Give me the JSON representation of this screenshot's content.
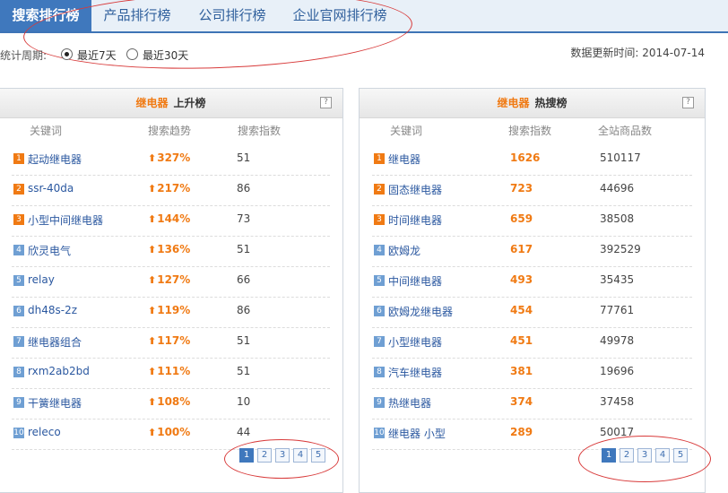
{
  "tabs": [
    {
      "label": "搜索排行榜",
      "active": true
    },
    {
      "label": "产品排行榜",
      "active": false
    },
    {
      "label": "公司排行榜",
      "active": false
    },
    {
      "label": "企业官网排行榜",
      "active": false
    }
  ],
  "period": {
    "label": "统计周期:",
    "options": [
      "最近7天",
      "最近30天"
    ],
    "selected": "最近7天"
  },
  "update": {
    "label": "数据更新时间:",
    "date": "2014-07-14"
  },
  "left_panel": {
    "keyword": "继电器",
    "title": "上升榜",
    "help": "?",
    "columns": [
      "关键词",
      "搜索趋势",
      "搜索指数"
    ],
    "rows": [
      {
        "rank": "1",
        "keyword": "起动继电器",
        "trend": "327%",
        "index": "51"
      },
      {
        "rank": "2",
        "keyword": "ssr-40da",
        "trend": "217%",
        "index": "86"
      },
      {
        "rank": "3",
        "keyword": "小型中间继电器",
        "trend": "144%",
        "index": "73"
      },
      {
        "rank": "4",
        "keyword": "欣灵电气",
        "trend": "136%",
        "index": "51"
      },
      {
        "rank": "5",
        "keyword": "relay",
        "trend": "127%",
        "index": "66"
      },
      {
        "rank": "6",
        "keyword": "dh48s-2z",
        "trend": "119%",
        "index": "86"
      },
      {
        "rank": "7",
        "keyword": "继电器组合",
        "trend": "117%",
        "index": "51"
      },
      {
        "rank": "8",
        "keyword": "rxm2ab2bd",
        "trend": "111%",
        "index": "51"
      },
      {
        "rank": "9",
        "keyword": "干簧继电器",
        "trend": "108%",
        "index": "10"
      },
      {
        "rank": "10",
        "keyword": "releco",
        "trend": "100%",
        "index": "44"
      }
    ],
    "pages": [
      "1",
      "2",
      "3",
      "4",
      "5"
    ],
    "current_page": "1"
  },
  "right_panel": {
    "keyword": "继电器",
    "title": "热搜榜",
    "help": "?",
    "columns": [
      "关键词",
      "搜索指数",
      "全站商品数"
    ],
    "rows": [
      {
        "rank": "1",
        "keyword": "继电器",
        "index": "1626",
        "count": "510117"
      },
      {
        "rank": "2",
        "keyword": "固态继电器",
        "index": "723",
        "count": "44696"
      },
      {
        "rank": "3",
        "keyword": "时间继电器",
        "index": "659",
        "count": "38508"
      },
      {
        "rank": "4",
        "keyword": "欧姆龙",
        "index": "617",
        "count": "392529"
      },
      {
        "rank": "5",
        "keyword": "中间继电器",
        "index": "493",
        "count": "35435"
      },
      {
        "rank": "6",
        "keyword": "欧姆龙继电器",
        "index": "454",
        "count": "77761"
      },
      {
        "rank": "7",
        "keyword": "小型继电器",
        "index": "451",
        "count": "49978"
      },
      {
        "rank": "8",
        "keyword": "汽车继电器",
        "index": "381",
        "count": "19696"
      },
      {
        "rank": "9",
        "keyword": "热继电器",
        "index": "374",
        "count": "37458"
      },
      {
        "rank": "10",
        "keyword": "继电器 小型",
        "index": "289",
        "count": "50017"
      }
    ],
    "pages": [
      "1",
      "2",
      "3",
      "4",
      "5"
    ],
    "current_page": "1"
  },
  "colors": {
    "accent": "#3f78bd",
    "highlight": "#f07a13",
    "annotation": "#d83a3a"
  }
}
